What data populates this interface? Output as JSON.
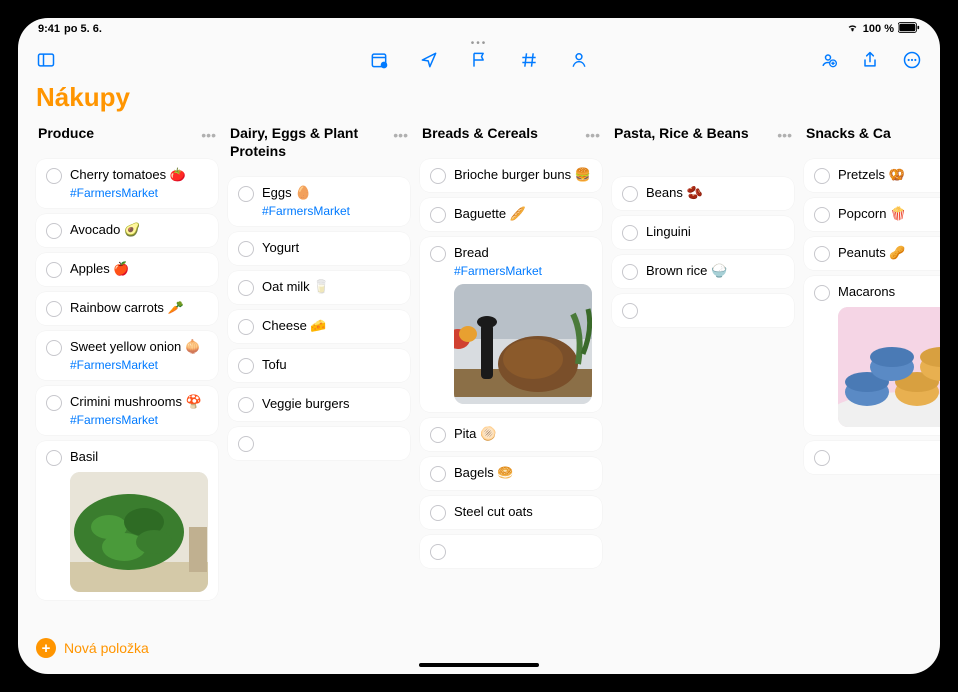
{
  "statusbar": {
    "time": "9:41",
    "date": "po 5. 6.",
    "wifi": "wifi",
    "battery_text": "100 %"
  },
  "list_title": "Nákupy",
  "columns": [
    {
      "title": "Produce",
      "items": [
        {
          "label": "Cherry tomatoes 🍅",
          "tag": "#FarmersMarket"
        },
        {
          "label": "Avocado 🥑"
        },
        {
          "label": "Apples 🍎"
        },
        {
          "label": "Rainbow carrots 🥕"
        },
        {
          "label": "Sweet yellow onion 🧅",
          "tag": "#FarmersMarket"
        },
        {
          "label": "Crimini mushrooms 🍄",
          "tag": "#FarmersMarket"
        },
        {
          "label": "Basil",
          "has_image": "basil"
        }
      ]
    },
    {
      "title": "Dairy, Eggs & Plant Proteins",
      "tall": true,
      "items": [
        {
          "label": "Eggs 🥚",
          "tag": "#FarmersMarket"
        },
        {
          "label": "Yogurt"
        },
        {
          "label": "Oat milk 🥛"
        },
        {
          "label": "Cheese 🧀"
        },
        {
          "label": "Tofu"
        },
        {
          "label": "Veggie burgers"
        },
        {
          "empty": true
        }
      ]
    },
    {
      "title": "Breads & Cereals",
      "items": [
        {
          "label": "Brioche burger buns 🍔"
        },
        {
          "label": "Baguette 🥖"
        },
        {
          "label": "Bread",
          "tag": "#FarmersMarket",
          "has_image": "bread"
        },
        {
          "label": "Pita 🫓"
        },
        {
          "label": "Bagels 🥯"
        },
        {
          "label": "Steel cut oats"
        },
        {
          "empty": true
        }
      ]
    },
    {
      "title": "Pasta, Rice & Beans",
      "tall": true,
      "items": [
        {
          "label": "Beans 🫘"
        },
        {
          "label": "Linguini"
        },
        {
          "label": "Brown rice 🍚"
        },
        {
          "empty": true
        }
      ]
    },
    {
      "title": "Snacks & Ca",
      "cut": true,
      "items": [
        {
          "label": "Pretzels 🥨"
        },
        {
          "label": "Popcorn 🍿"
        },
        {
          "label": "Peanuts 🥜"
        },
        {
          "label": "Macarons",
          "has_image": "macarons"
        },
        {
          "empty": true
        }
      ]
    }
  ],
  "bottom": {
    "new_item_label": "Nová položka"
  }
}
